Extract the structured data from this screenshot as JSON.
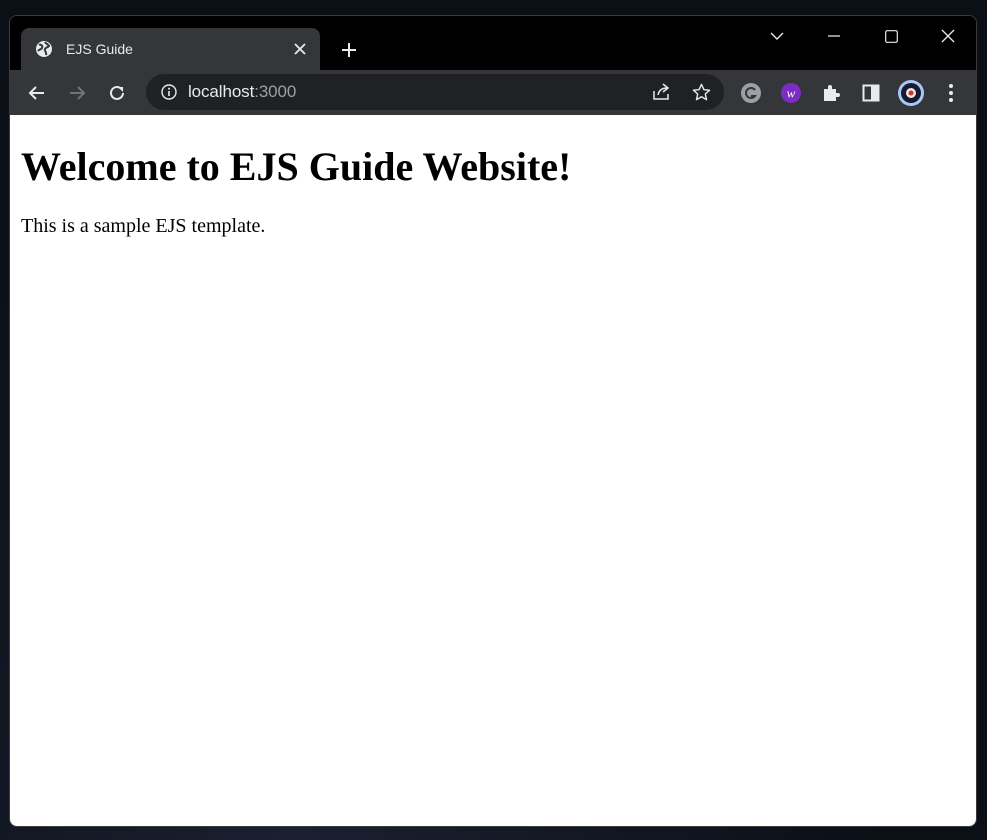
{
  "browser": {
    "tab": {
      "title": "EJS Guide",
      "favicon": "globe-icon"
    },
    "address_bar": {
      "host": "localhost",
      "port": ":3000"
    },
    "colors": {
      "frame": "#000000",
      "toolbar": "#35363a",
      "omnibox": "#202124",
      "text": "#e8eaed",
      "dim": "#9aa0a6",
      "content": "#ffffff"
    },
    "toolbar_icons": [
      "back-icon",
      "forward-icon",
      "reload-icon",
      "info-icon",
      "share-icon",
      "bookmark-star-icon",
      "grammarly-extension-icon",
      "w-extension-icon",
      "extensions-puzzle-icon",
      "side-panel-icon",
      "profile-avatar",
      "menu-kebab-icon"
    ],
    "window_controls": [
      "tab-search-icon",
      "minimize-icon",
      "maximize-icon",
      "close-icon"
    ]
  },
  "page": {
    "heading": "Welcome to EJS Guide Website!",
    "paragraph": "This is a sample EJS template."
  }
}
